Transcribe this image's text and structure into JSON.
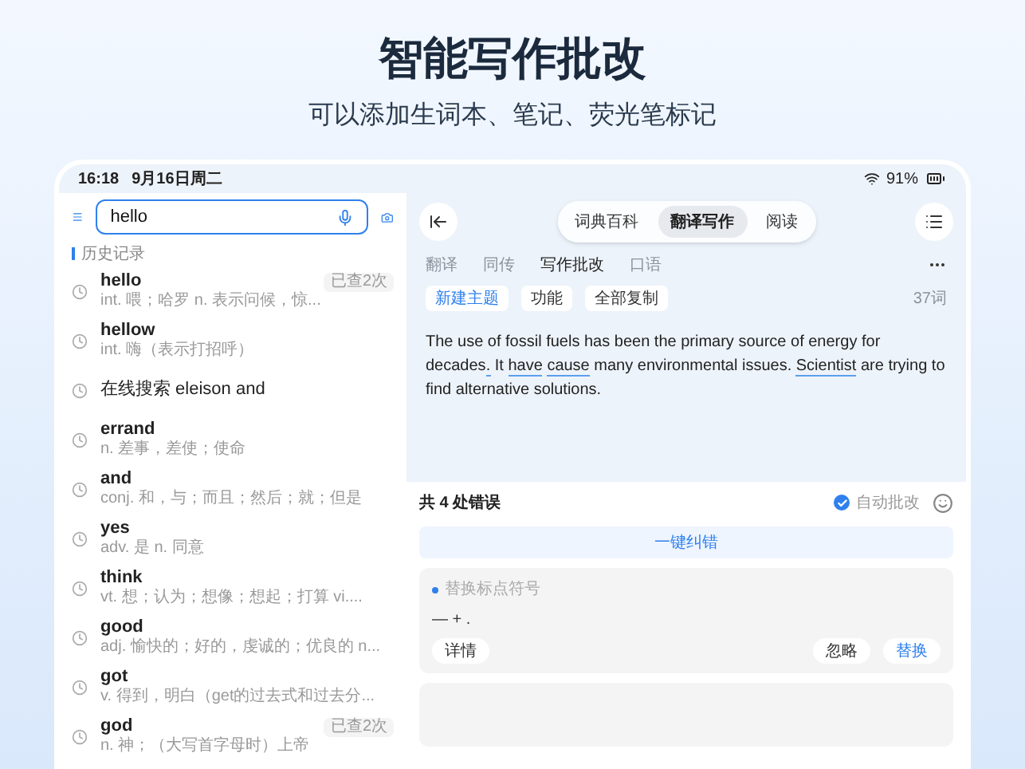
{
  "headline": "智能写作批改",
  "subheadline": "可以添加生词本、笔记、荧光笔标记",
  "status_bar": {
    "time": "16:18",
    "date": "9月16日周二",
    "battery": "91%"
  },
  "search": {
    "value": "hello"
  },
  "history": {
    "title": "历史记录",
    "items": [
      {
        "kind": "word",
        "word": "hello",
        "definition": "int. 喂；哈罗 n. 表示问候，惊...",
        "badge": "已查2次"
      },
      {
        "kind": "word",
        "word": "hellow",
        "definition": "int. 嗨（表示打招呼）"
      },
      {
        "kind": "online",
        "word": "在线搜索 eleison and"
      },
      {
        "kind": "word",
        "word": "errand",
        "definition": "n. 差事，差使；使命"
      },
      {
        "kind": "word",
        "word": "and",
        "definition": "conj. 和，与；而且；然后；就；但是"
      },
      {
        "kind": "word",
        "word": "yes",
        "definition": "adv. 是 n. 同意"
      },
      {
        "kind": "word",
        "word": "think",
        "definition": "vt. 想；认为；想像；想起；打算 vi...."
      },
      {
        "kind": "word",
        "word": "good",
        "definition": "adj. 愉快的；好的，虔诚的；优良的 n..."
      },
      {
        "kind": "word",
        "word": "got",
        "definition": "v. 得到，明白（get的过去式和过去分..."
      },
      {
        "kind": "word",
        "word": "god",
        "definition": "n. 神；（大写首字母时）上帝",
        "badge": "已查2次"
      }
    ]
  },
  "nav_tabs": [
    {
      "label": "词典百科",
      "selected": false
    },
    {
      "label": "翻译写作",
      "selected": true
    },
    {
      "label": "阅读",
      "selected": false
    }
  ],
  "sub_tabs": [
    {
      "label": "翻译",
      "selected": false
    },
    {
      "label": "同传",
      "selected": false
    },
    {
      "label": "写作批改",
      "selected": true
    },
    {
      "label": "口语",
      "selected": false
    }
  ],
  "actions": [
    {
      "label": "新建主题",
      "selected": true
    },
    {
      "label": "功能",
      "selected": false
    },
    {
      "label": "全部复制",
      "selected": false
    }
  ],
  "word_count": "37词",
  "essay": [
    {
      "text": "The use of fossil fuels has been the primary source of energy for decades",
      "flagged": false
    },
    {
      "text": ".",
      "flagged": true
    },
    {
      "text": " It ",
      "flagged": false
    },
    {
      "text": "have",
      "flagged": true
    },
    {
      "text": "cause",
      "flagged": true
    },
    {
      "text": " many environmental issues. ",
      "flagged": false
    },
    {
      "text": "Scientist",
      "flagged": true
    },
    {
      "text": " are trying to find alternative solutions.",
      "flagged": false
    }
  ],
  "errors": {
    "summary": "共 4 处错误",
    "auto_correct": {
      "label": "自动批改",
      "checked": true
    },
    "fix_all": "一键纠错",
    "cards": [
      {
        "type": "替换标点符号",
        "content": "— + .",
        "detail": "详情",
        "ignore": "忽略",
        "replace": "替换"
      }
    ]
  }
}
